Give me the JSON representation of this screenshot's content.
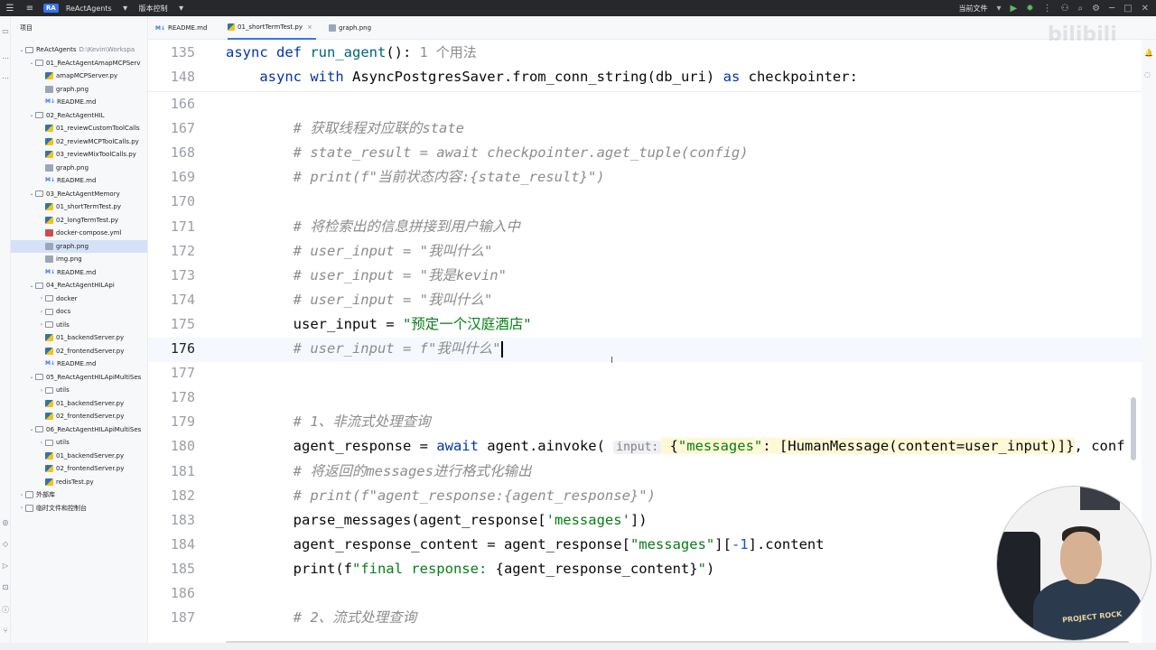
{
  "titlebar": {
    "project_badge": "RA",
    "project_name": "ReActAgents",
    "vcs_label": "版本控制",
    "run_config": "当前文件"
  },
  "project_panel": {
    "header": "项目",
    "items": [
      {
        "label": "ReActAgents",
        "path": "D:\\Kevin\\Workspa",
        "type": "folder",
        "indent": 0,
        "open": true
      },
      {
        "label": "01_ReActAgentAmapMCPServ",
        "type": "folder",
        "indent": 1,
        "open": true
      },
      {
        "label": "amapMCPServer.py",
        "type": "py",
        "indent": 2
      },
      {
        "label": "graph.png",
        "type": "png",
        "indent": 2
      },
      {
        "label": "README.md",
        "type": "md",
        "indent": 2
      },
      {
        "label": "02_ReActAgentHIL",
        "type": "folder",
        "indent": 1,
        "open": true
      },
      {
        "label": "01_reviewCustomToolCalls",
        "type": "py",
        "indent": 2
      },
      {
        "label": "02_reviewMCPToolCalls.py",
        "type": "py",
        "indent": 2
      },
      {
        "label": "03_reviewMixToolCalls.py",
        "type": "py",
        "indent": 2
      },
      {
        "label": "graph.png",
        "type": "png",
        "indent": 2
      },
      {
        "label": "README.md",
        "type": "md",
        "indent": 2
      },
      {
        "label": "03_ReActAgentMemory",
        "type": "folder",
        "indent": 1,
        "open": true
      },
      {
        "label": "01_shortTermTest.py",
        "type": "py",
        "indent": 2
      },
      {
        "label": "02_longTermTest.py",
        "type": "py",
        "indent": 2
      },
      {
        "label": "docker-compose.yml",
        "type": "yml",
        "indent": 2
      },
      {
        "label": "graph.png",
        "type": "png",
        "indent": 2,
        "selected": true
      },
      {
        "label": "img.png",
        "type": "png",
        "indent": 2
      },
      {
        "label": "README.md",
        "type": "md",
        "indent": 2
      },
      {
        "label": "04_ReActAgentHILApi",
        "type": "folder",
        "indent": 1,
        "open": true
      },
      {
        "label": "docker",
        "type": "folder",
        "indent": 2,
        "open": false
      },
      {
        "label": "docs",
        "type": "folder",
        "indent": 2,
        "open": false
      },
      {
        "label": "utils",
        "type": "folder",
        "indent": 2,
        "open": false
      },
      {
        "label": "01_backendServer.py",
        "type": "py",
        "indent": 2
      },
      {
        "label": "02_frontendServer.py",
        "type": "py",
        "indent": 2
      },
      {
        "label": "README.md",
        "type": "md",
        "indent": 2
      },
      {
        "label": "05_ReActAgentHILApiMultiSes",
        "type": "folder",
        "indent": 1,
        "open": true
      },
      {
        "label": "utils",
        "type": "folder",
        "indent": 2,
        "open": false
      },
      {
        "label": "01_backendServer.py",
        "type": "py",
        "indent": 2
      },
      {
        "label": "02_frontendServer.py",
        "type": "py",
        "indent": 2
      },
      {
        "label": "06_ReActAgentHILApiMultiSes",
        "type": "folder",
        "indent": 1,
        "open": true
      },
      {
        "label": "utils",
        "type": "folder",
        "indent": 2,
        "open": false
      },
      {
        "label": "01_backendServer.py",
        "type": "py",
        "indent": 2
      },
      {
        "label": "02_frontendServer.py",
        "type": "py",
        "indent": 2
      },
      {
        "label": "redisTest.py",
        "type": "py",
        "indent": 2
      },
      {
        "label": "外部库",
        "type": "lib",
        "indent": 0,
        "open": false
      },
      {
        "label": "临时文件和控制台",
        "type": "lib",
        "indent": 0,
        "open": false
      }
    ]
  },
  "tabs": [
    {
      "label": "README.md",
      "icon": "md"
    },
    {
      "label": "01_shortTermTest.py",
      "icon": "py",
      "active": true,
      "close": "×"
    },
    {
      "label": "graph.png",
      "icon": "png"
    }
  ],
  "editor": {
    "sticky": [
      {
        "num": "135",
        "tokens": [
          [
            "kw",
            "async "
          ],
          [
            "kw",
            "def "
          ],
          [
            "fn",
            "run_agent"
          ],
          [
            "",
            "(): "
          ],
          [
            "hint",
            "1 个用法"
          ]
        ]
      },
      {
        "num": "148",
        "tokens": [
          [
            "",
            "    "
          ],
          [
            "kw",
            "async "
          ],
          [
            "kw",
            "with "
          ],
          [
            "",
            "AsyncPostgresSaver.from_conn_string(db_uri) "
          ],
          [
            "kw",
            "as "
          ],
          [
            "",
            "checkpointer:"
          ]
        ]
      }
    ],
    "lines": [
      {
        "num": "166",
        "tokens": []
      },
      {
        "num": "167",
        "tokens": [
          [
            "",
            "        "
          ],
          [
            "cm",
            "# 获取线程对应联的state"
          ]
        ]
      },
      {
        "num": "168",
        "tokens": [
          [
            "",
            "        "
          ],
          [
            "cm",
            "# state_result = await checkpointer.aget_tuple(config)"
          ]
        ]
      },
      {
        "num": "169",
        "tokens": [
          [
            "",
            "        "
          ],
          [
            "cm",
            "# print(f\"当前状态内容:{state_result}\")"
          ]
        ]
      },
      {
        "num": "170",
        "tokens": []
      },
      {
        "num": "171",
        "tokens": [
          [
            "",
            "        "
          ],
          [
            "cm",
            "# 将检索出的信息拼接到用户输入中"
          ]
        ]
      },
      {
        "num": "172",
        "tokens": [
          [
            "",
            "        "
          ],
          [
            "cm",
            "# user_input = \"我叫什么\""
          ]
        ]
      },
      {
        "num": "173",
        "tokens": [
          [
            "",
            "        "
          ],
          [
            "cm",
            "# user_input = \"我是kevin\""
          ]
        ]
      },
      {
        "num": "174",
        "tokens": [
          [
            "",
            "        "
          ],
          [
            "cm",
            "# user_input = \"我叫什么\""
          ]
        ]
      },
      {
        "num": "175",
        "tokens": [
          [
            "",
            "        user_input = "
          ],
          [
            "str",
            "\"预定一个汉庭酒店\""
          ]
        ]
      },
      {
        "num": "176",
        "tokens": [
          [
            "",
            "        "
          ],
          [
            "cm",
            "# user_input = f\"我叫什么\""
          ]
        ],
        "caret": true
      },
      {
        "num": "177",
        "tokens": []
      },
      {
        "num": "178",
        "tokens": []
      },
      {
        "num": "179",
        "tokens": [
          [
            "",
            "        "
          ],
          [
            "cm",
            "# 1、非流式处理查询"
          ]
        ]
      },
      {
        "num": "180",
        "tokens": [
          [
            "",
            "        agent_response = "
          ],
          [
            "kw",
            "await "
          ],
          [
            "",
            "agent.ainvoke( "
          ],
          [
            "inlay",
            "input:"
          ],
          [
            "hl",
            " {"
          ],
          [
            "hl-str",
            "\"messages\""
          ],
          [
            "hl",
            ": [HumanMessage(content=user_input)]}"
          ],
          [
            "",
            ", conf"
          ]
        ]
      },
      {
        "num": "181",
        "tokens": [
          [
            "",
            "        "
          ],
          [
            "cm",
            "# 将返回的messages进行格式化输出"
          ]
        ]
      },
      {
        "num": "182",
        "tokens": [
          [
            "",
            "        "
          ],
          [
            "cm",
            "# print(f\"agent_response:{agent_response}\")"
          ]
        ]
      },
      {
        "num": "183",
        "tokens": [
          [
            "",
            "        parse_messages(agent_response["
          ],
          [
            "str",
            "'messages'"
          ],
          [
            "",
            "])"
          ]
        ]
      },
      {
        "num": "184",
        "tokens": [
          [
            "",
            "        agent_response_content = agent_response["
          ],
          [
            "str",
            "\"messages\""
          ],
          [
            "",
            "]["
          ],
          [
            "num",
            "-1"
          ],
          [
            "",
            "].content"
          ]
        ]
      },
      {
        "num": "185",
        "tokens": [
          [
            "",
            "        print(f"
          ],
          [
            "str",
            "\"final response: "
          ],
          [
            "",
            "{agent_response_content}"
          ],
          [
            "str",
            "\""
          ],
          [
            "",
            ")"
          ]
        ]
      },
      {
        "num": "186",
        "tokens": []
      },
      {
        "num": "187",
        "tokens": [
          [
            "",
            "        "
          ],
          [
            "cm",
            "# 2、流式处理查询"
          ]
        ]
      }
    ]
  },
  "watermark": "bilibili",
  "webcam": {
    "shirt_text": "PROJECT ROCK"
  },
  "colors": {
    "accent": "#3574f0",
    "keyword": "#0033b3",
    "comment": "#8c8c8c",
    "string": "#067d17",
    "number": "#1750eb"
  }
}
